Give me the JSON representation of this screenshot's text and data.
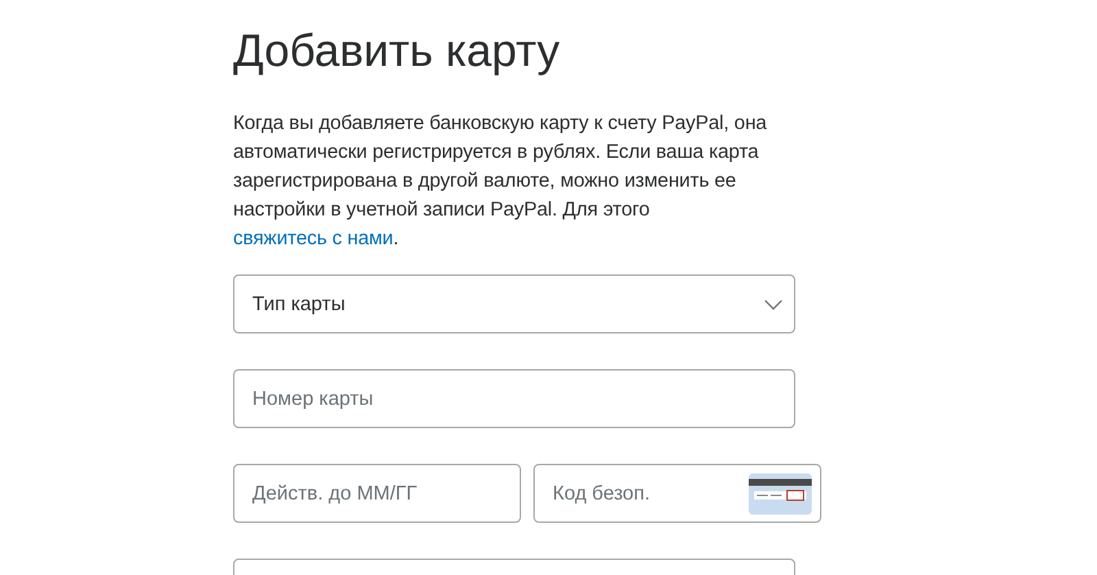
{
  "title": "Добавить карту",
  "intro": {
    "text": "Когда вы добавляете банковскую карту к счету PayPal, она автоматически регистрируется в рублях. Если ваша карта зарегистрирована в другой валюте, можно изменить ее настройки в учетной записи PayPal. Для этого",
    "link": "свяжитесь с нами",
    "end": "."
  },
  "rows": [
    [
      {
        "kind": "select",
        "value": "Тип карты"
      }
    ],
    [
      {
        "kind": "input",
        "placeholder": "Номер карты"
      }
    ],
    [
      {
        "kind": "input",
        "placeholder": "Действ. до ММ/ГГ"
      },
      {
        "kind": "cvv",
        "placeholder": "Код безоп."
      }
    ],
    [
      {
        "kind": "input"
      }
    ]
  ]
}
